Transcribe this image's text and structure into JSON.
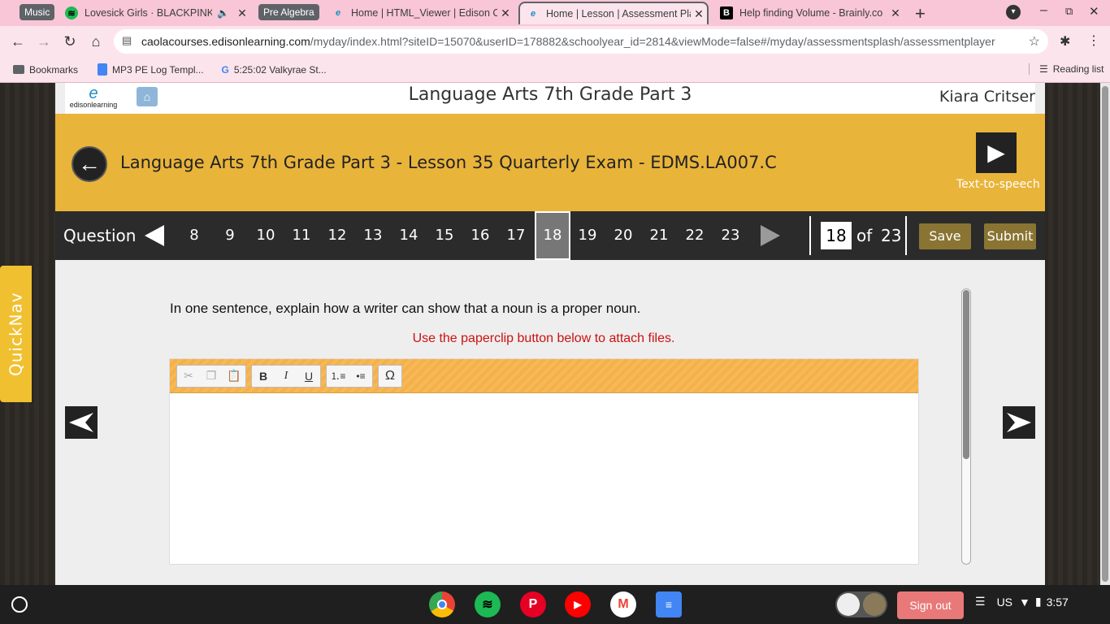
{
  "browser": {
    "tab_groups": [
      "Music",
      "Pre Algebra"
    ],
    "tabs": [
      {
        "title": "Lovesick Girls · BLACKPINK",
        "favicon": "spotify-icon"
      },
      {
        "title": "Home | HTML_Viewer | Edison C",
        "favicon": "edison-icon"
      },
      {
        "title": "Home | Lesson | Assessment Pla",
        "favicon": "edison-icon"
      },
      {
        "title": "Help finding Volume - Brainly.co",
        "favicon": "brainly-icon"
      }
    ],
    "url_host": "caolacourses.edisonlearning.com",
    "url_path": "/myday/index.html?siteID=15070&userID=178882&schoolyear_id=2814&viewMode=false#/myday/assessmentsplash/assessmentplayer",
    "bookmarks": [
      "Bookmarks",
      "MP3 PE Log Templ...",
      "5:25:02 Valkyrae St..."
    ],
    "reading_list": "Reading list"
  },
  "app": {
    "logo_text": "edisonlearning",
    "course_title": "Language Arts 7th Grade Part 3",
    "student_name": "Kiara Critser",
    "lesson_title": "Language Arts 7th Grade Part 3 - Lesson 35 Quarterly Exam - EDMS.LA007.C",
    "tts_label": "Text-to-speech",
    "question_label": "Question",
    "question_numbers": [
      "8",
      "9",
      "10",
      "11",
      "12",
      "13",
      "14",
      "15",
      "16",
      "17",
      "18",
      "19",
      "20",
      "21",
      "22",
      "23"
    ],
    "current_question": "18",
    "of_label": "of",
    "total_questions": "23",
    "save_label": "Save",
    "submit_label": "Submit",
    "prompt": "In one sentence, explain how a writer can show that a noun is a proper noun.",
    "note": "Use the paperclip button below to attach files.",
    "quicknav_label": "QuickNav"
  },
  "shelf": {
    "signout_label": "Sign out",
    "locale": "US",
    "time": "3:57"
  }
}
